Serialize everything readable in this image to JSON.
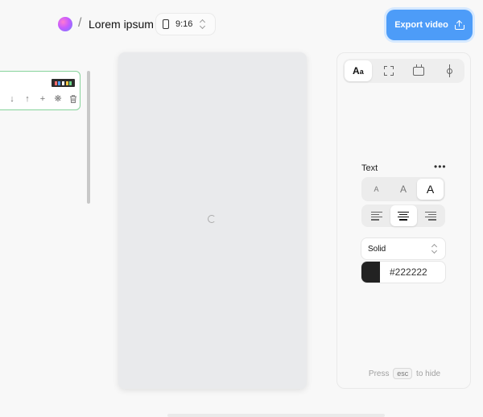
{
  "header": {
    "separator": "/",
    "project_title": "Lorem ipsum",
    "aspect_ratio": "9:16",
    "export_label": "Export video",
    "accent_color": "#4d9cf8"
  },
  "clip": {
    "thumbnail_colors": [
      "#ff6b6b",
      "#4d9cf8",
      "#ffffff",
      "#f4c542",
      "#6bd68a"
    ],
    "tools": [
      "arrow-down-icon",
      "arrow-up-icon",
      "plus-icon",
      "loading-icon",
      "trash-icon"
    ],
    "border_color": "#86d39b"
  },
  "canvas": {
    "background": "#e9eaec",
    "state": "loading"
  },
  "panel": {
    "tabs": [
      {
        "name": "text",
        "label_big": "A",
        "label_small": "a",
        "active": true
      },
      {
        "name": "frame",
        "active": false
      },
      {
        "name": "display",
        "active": false
      },
      {
        "name": "position",
        "active": false
      }
    ],
    "text_section": {
      "label": "Text",
      "more_label": "•••",
      "sizes": [
        {
          "label": "A",
          "active": false
        },
        {
          "label": "A",
          "active": false
        },
        {
          "label": "A",
          "active": true
        }
      ],
      "alignment": "center",
      "style_select": "Solid",
      "color_hex": "#222222",
      "color": "#222222"
    },
    "hint": {
      "prefix": "Press",
      "key": "esc",
      "suffix": "to hide"
    }
  }
}
